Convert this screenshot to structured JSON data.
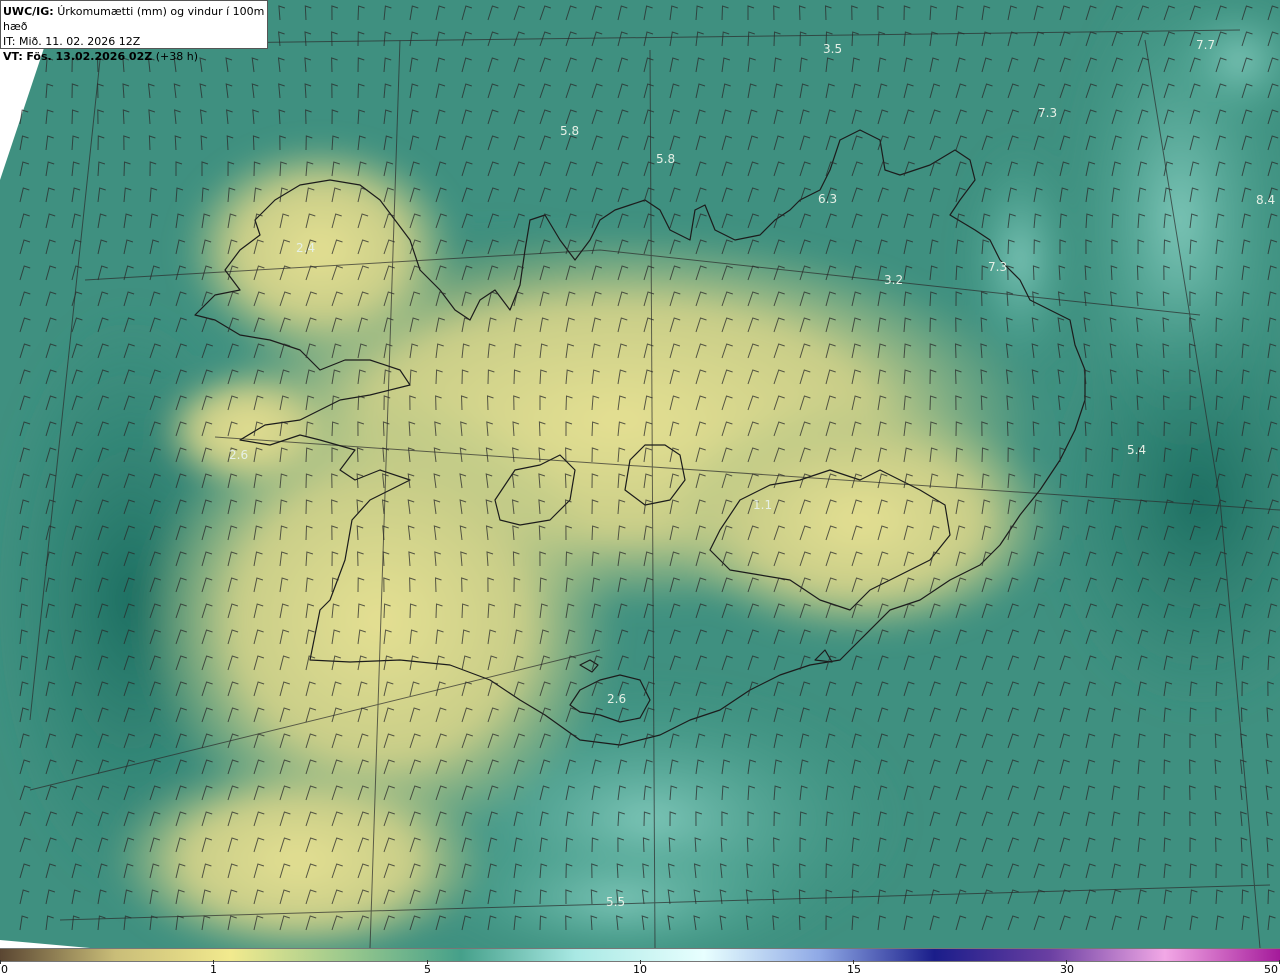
{
  "header": {
    "product": "UWC/IG:",
    "description": "Úrkomumætti (mm) og vindur í 100m hæð",
    "initial_time": "IT: Mið. 11. 02. 2026 12Z",
    "valid_prefix": "VT:",
    "valid_time": "Fös. 13.02.2026 02Z",
    "lead": "(+38 h)"
  },
  "map_labels": [
    "3.5",
    "7.7",
    "5.8",
    "5.8",
    "7.3",
    "6.3",
    "8.4",
    "2.4",
    "7.3",
    "3.2",
    "5.4",
    "2.6",
    "1.1",
    "2.6",
    "5.5"
  ],
  "colorbar": {
    "ticks": [
      "0",
      "1",
      "5",
      "10",
      "15",
      "30",
      "50"
    ],
    "colors": [
      "#5a4632",
      "#c9bd78",
      "#f2ea8e",
      "#9bc98d",
      "#45a08a",
      "#a9e9e4",
      "#e8ffff",
      "#8fa9e6",
      "#1a1d8a",
      "#6a3fa2",
      "#f2a8e6",
      "#a41a9a"
    ]
  },
  "colors": {
    "sea_teal": "#2f8574",
    "land_yellow": "#e1dc8d",
    "coast": "#1c1c1c",
    "barb": "#2a2a2a"
  }
}
